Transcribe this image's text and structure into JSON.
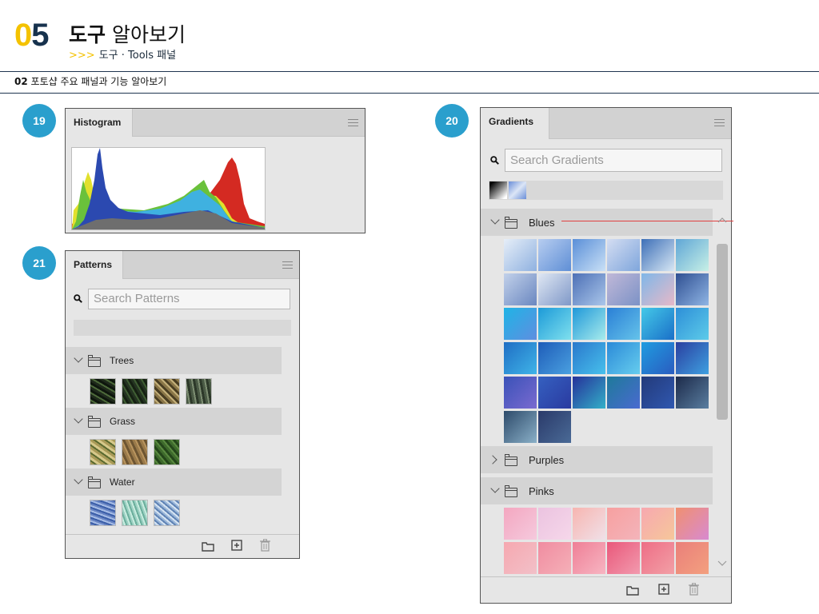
{
  "header": {
    "chapter_number_a": "0",
    "chapter_number_b": "5",
    "title_bold": "도구",
    "title_rest": "알아보기",
    "sub_arrows": ">>>",
    "subtitle": "도구 · Tools 패널",
    "section_number": "02",
    "section_text": "포토샵 주요 패널과 기능 알아보기"
  },
  "badges": [
    "19",
    "20",
    "21"
  ],
  "histogram_panel": {
    "tab": "Histogram",
    "menu_icon": "panel-menu-icon",
    "channel_colors": [
      "#d42a22",
      "#2b49b0",
      "#3fb1e0",
      "#6ac13b",
      "#e1e02c",
      "#6e6e6e"
    ]
  },
  "patterns_panel": {
    "tab": "Patterns",
    "search_placeholder": "Search Patterns",
    "groups": [
      {
        "name": "Trees",
        "expanded": true,
        "swatches": [
          "#1f2a1b",
          "#243321",
          "#8a7648",
          "#4a5a45"
        ]
      },
      {
        "name": "Grass",
        "expanded": true,
        "swatches": [
          "#a99a58",
          "#9a7a4a",
          "#3e6a2c"
        ]
      },
      {
        "name": "Water",
        "expanded": true,
        "swatches": [
          "#6a86c4",
          "#9cd0c2",
          "#9ab6d8"
        ]
      }
    ],
    "footer_icons": [
      "new-group-icon",
      "new-pattern-icon",
      "delete-icon"
    ]
  },
  "gradients_panel": {
    "tab": "Gradients",
    "search_placeholder": "Search Gradients",
    "recent": [
      "black-white",
      "blue-light"
    ],
    "groups": [
      {
        "name": "Blues",
        "expanded": true
      },
      {
        "name": "Purples",
        "expanded": false
      },
      {
        "name": "Pinks",
        "expanded": true
      }
    ],
    "blues_swatches": [
      [
        "#e6eef8",
        "#8fb1e0"
      ],
      [
        "#b7cdf0",
        "#5f8fd6"
      ],
      [
        "#5a8fd8",
        "#c9e0f6"
      ],
      [
        "#d4ddf2",
        "#7fa6dc"
      ],
      [
        "#3d6fb7",
        "#d7e7f4"
      ],
      [
        "#5fa6d6",
        "#c7f0e6"
      ],
      [
        "#c2d1ea",
        "#6a87c0"
      ],
      [
        "#dfe7f3",
        "#7f98c8"
      ],
      [
        "#4d70b6",
        "#aac6ea"
      ],
      [
        "#c0b8d8",
        "#7c92c6"
      ],
      [
        "#7fb7e8",
        "#e7b8c8"
      ],
      [
        "#2f4f92",
        "#8fb5e4"
      ],
      [
        "#1fb4e6",
        "#5f8ee0"
      ],
      [
        "#1c9ad8",
        "#7fe0ee"
      ],
      [
        "#1f98d9",
        "#a8ecec"
      ],
      [
        "#2a7fd6",
        "#65c3ea"
      ],
      [
        "#44c9e8",
        "#1a6fc8"
      ],
      [
        "#2d8fd8",
        "#5dcbe9"
      ],
      [
        "#1f6ec4",
        "#3fb4e8"
      ],
      [
        "#1e5cb8",
        "#4aa0e0"
      ],
      [
        "#2a78cc",
        "#47c0ec"
      ],
      [
        "#2b8ad8",
        "#66cdee"
      ],
      [
        "#1f9ce0",
        "#2a5cc0"
      ],
      [
        "#2a3fa0",
        "#3fa0e0"
      ],
      [
        "#3a52b8",
        "#7a6ad0"
      ],
      [
        "#3560c0",
        "#2a3aa0"
      ],
      [
        "#26319a",
        "#33b0c8"
      ],
      [
        "#1e7a9a",
        "#4a6ad0"
      ],
      [
        "#233a7a",
        "#3058b0"
      ],
      [
        "#1c2a4a",
        "#5a7ea0"
      ],
      [
        "#2d4a6a",
        "#8ab0c8"
      ],
      [
        "#2a3a6a",
        "#4a6a96"
      ]
    ],
    "pinks_swatches": [
      [
        "#f4a7c0",
        "#f5c9dd"
      ],
      [
        "#ebc3e0",
        "#f6d7ea"
      ],
      [
        "#f7b5b0",
        "#f0e0e8"
      ],
      [
        "#f7a0a0",
        "#f3b4ba"
      ],
      [
        "#f7a8b0",
        "#f6c79a"
      ],
      [
        "#f09070",
        "#d88ad0"
      ],
      [
        "#f6a8b0",
        "#f2c0c8"
      ],
      [
        "#f08ca0",
        "#f5b0b8"
      ],
      [
        "#ef7f96",
        "#f7b5c2"
      ],
      [
        "#e9587a",
        "#f29aae"
      ],
      [
        "#ee6d86",
        "#f2a0a6"
      ],
      [
        "#ea7f7a",
        "#f3a07f"
      ]
    ],
    "footer_icons": [
      "new-group-icon",
      "new-gradient-icon",
      "delete-icon"
    ]
  }
}
